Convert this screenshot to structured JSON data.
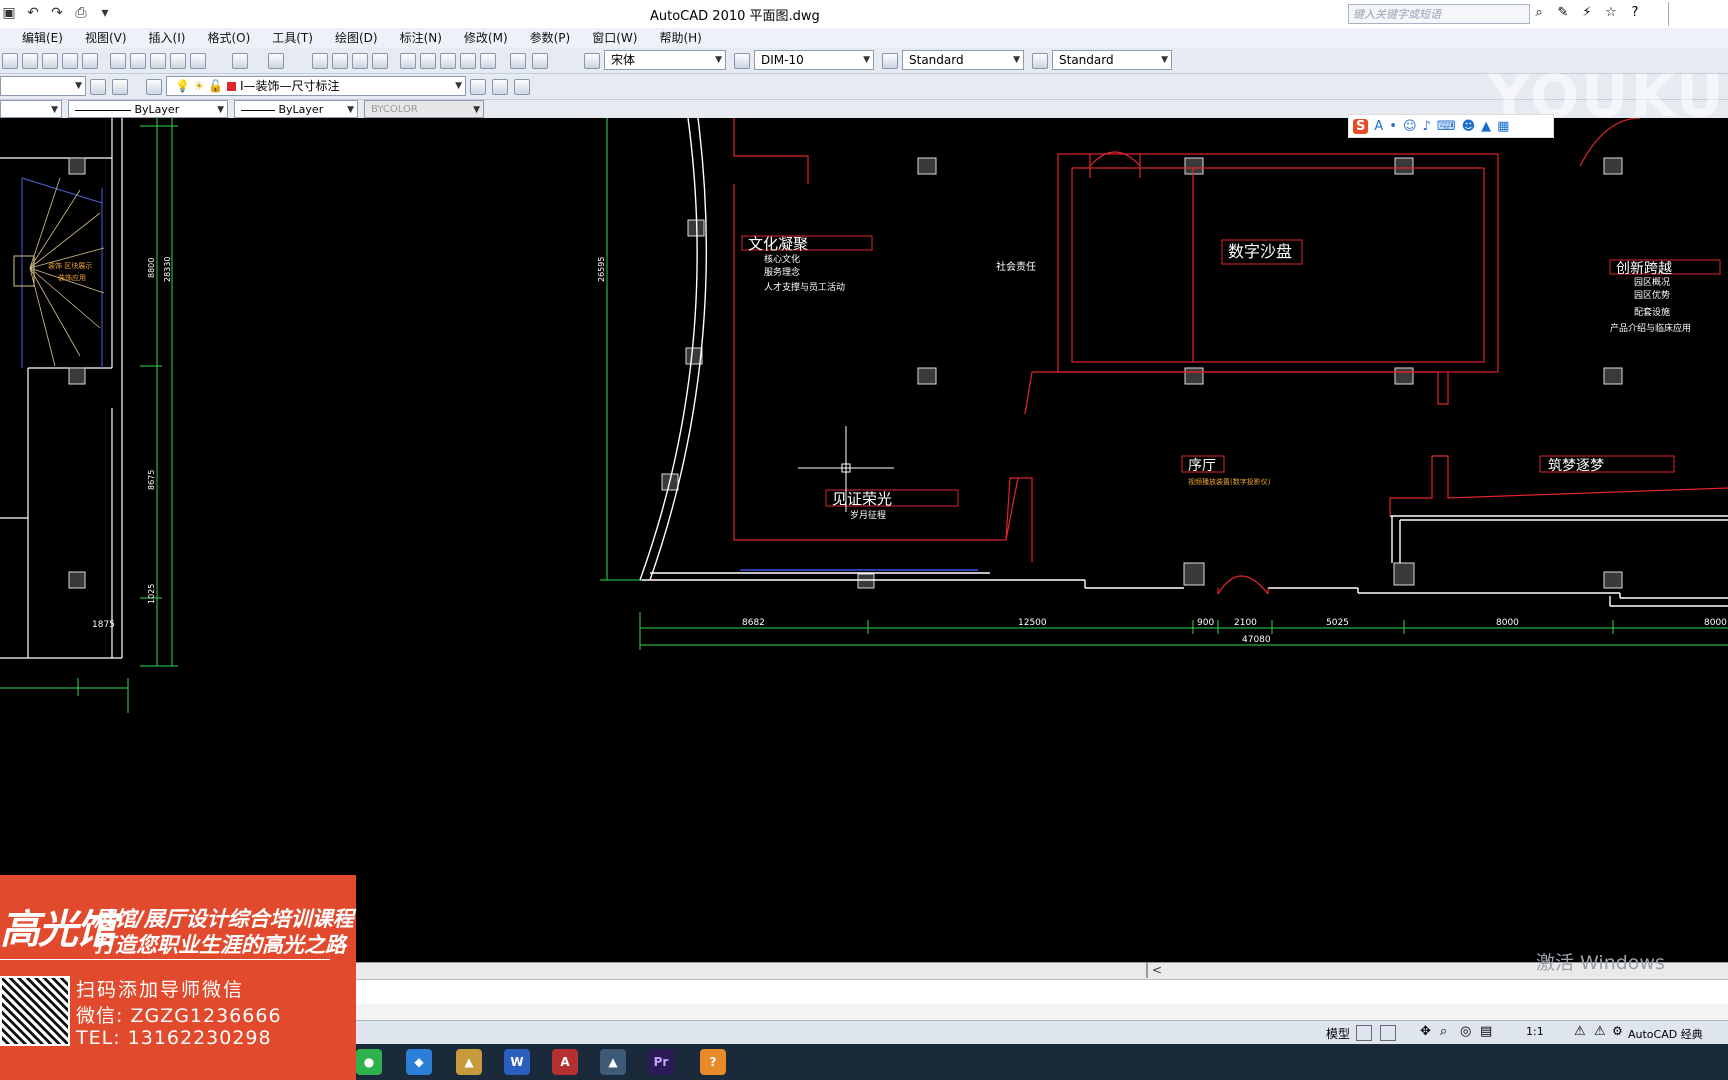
{
  "window": {
    "title": "AutoCAD 2010      平面图.dwg",
    "search_placeholder": "键入关键字或短语"
  },
  "menus": [
    "编辑(E)",
    "视图(V)",
    "插入(I)",
    "格式(O)",
    "工具(T)",
    "绘图(D)",
    "标注(N)",
    "修改(M)",
    "参数(P)",
    "窗口(W)",
    "帮助(H)"
  ],
  "toolbar": {
    "text_font": "宋体",
    "dim_style": "DIM-10",
    "table_style": "Standard",
    "multileader_style": "Standard",
    "layer": "I—装饰—尺寸标注",
    "linetype": "ByLayer",
    "lineweight": "ByLayer",
    "plot_style": "BYCOLOR"
  },
  "watermark": {
    "brand": "YOUKU",
    "activate_windows": "激活 Windows"
  },
  "drawing": {
    "rooms": [
      {
        "name": "文化凝聚",
        "items": [
          "核心文化",
          "服务理念",
          "人才支撑与员工活动"
        ]
      },
      {
        "name": "社会责任"
      },
      {
        "name": "数字沙盘"
      },
      {
        "name": "创新跨越",
        "items": [
          "园区概况",
          "园区优势",
          "配套设施",
          "产品介绍与临床应用"
        ]
      },
      {
        "name": "序厅",
        "items": [
          "视频播放装置(数字投影仪)"
        ]
      },
      {
        "name": "筑梦逐梦"
      },
      {
        "name": "见证荣光",
        "items": [
          "岁月征程"
        ]
      }
    ],
    "stair_labels": [
      "装饰 区块展示",
      "装饰应用"
    ],
    "dimensions_bottom": [
      "1875",
      "8682",
      "12500",
      "900",
      "2100",
      "5025",
      "8000",
      "8000",
      "47080"
    ],
    "dimensions_vertical": [
      "8800",
      "28330",
      "8675",
      "1025",
      "26595"
    ]
  },
  "command": {
    "scroll_marker": "<"
  },
  "status": {
    "model_tab": "模型",
    "scale": "1:1",
    "workspace": "AutoCAD 经典"
  },
  "ad": {
    "brand": "高光馆",
    "slogan1": "展馆/展厅设计综合培训课程",
    "slogan2": "打造您职业生涯的高光之路",
    "scan_text": "扫码添加导师微信",
    "wechat": "微信: ZGZG1236666",
    "tel": "TEL: 13162230298"
  },
  "colors": {
    "wall_red": "#e0262b",
    "dim_green": "#2fd84b",
    "bg": "#000000",
    "ad_red": "#e24a2d"
  }
}
